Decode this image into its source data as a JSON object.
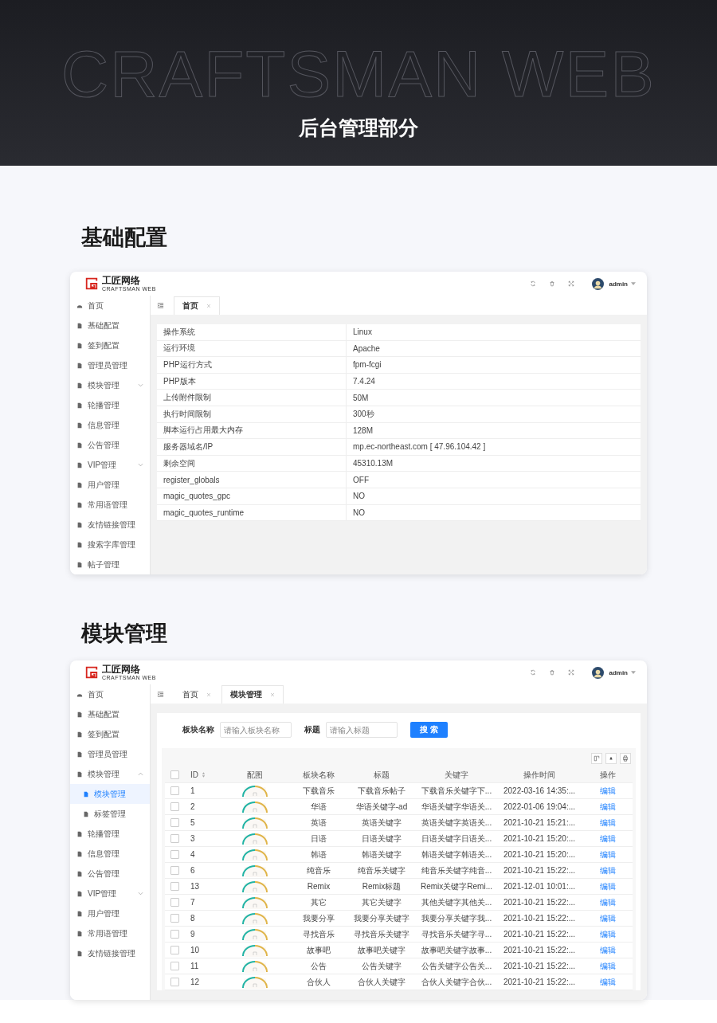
{
  "banner": {
    "lettering": "CRAFTSMAN WEB",
    "title": "后台管理部分"
  },
  "sections": [
    {
      "heading": "基础配置",
      "kind": "info",
      "app": {
        "brand": "工匠网络",
        "tagline": "CRAFTSMAN WEB",
        "user": "admin",
        "sidebar": [
          {
            "label": "首页",
            "kind": "home",
            "selected": false
          },
          {
            "label": "基础配置",
            "kind": "page",
            "selected": false
          },
          {
            "label": "签到配置",
            "kind": "page",
            "selected": false
          },
          {
            "label": "管理员管理",
            "kind": "page",
            "selected": false
          },
          {
            "label": "模块管理",
            "kind": "page",
            "selected": false,
            "expanded": false
          },
          {
            "label": "轮播管理",
            "kind": "page",
            "selected": false
          },
          {
            "label": "信息管理",
            "kind": "page",
            "selected": false
          },
          {
            "label": "公告管理",
            "kind": "page",
            "selected": false
          },
          {
            "label": "VIP管理",
            "kind": "page",
            "selected": false,
            "expanded": false
          },
          {
            "label": "用户管理",
            "kind": "page",
            "selected": false
          },
          {
            "label": "常用语管理",
            "kind": "page",
            "selected": false
          },
          {
            "label": "友情链接管理",
            "kind": "page",
            "selected": false
          },
          {
            "label": "搜索字库管理",
            "kind": "page",
            "selected": false
          },
          {
            "label": "帖子管理",
            "kind": "page",
            "selected": false
          }
        ],
        "tabs": [
          {
            "label": "首页",
            "selected": true
          }
        ],
        "info_rows": [
          {
            "key": "操作系统",
            "value": "Linux"
          },
          {
            "key": "运行环境",
            "value": "Apache"
          },
          {
            "key": "PHP运行方式",
            "value": "fpm-fcgi"
          },
          {
            "key": "PHP版本",
            "value": "7.4.24"
          },
          {
            "key": "上传附件限制",
            "value": "50M"
          },
          {
            "key": "执行时间限制",
            "value": "300秒"
          },
          {
            "key": "脚本运行占用最大内存",
            "value": "128M"
          },
          {
            "key": "服务器域名/IP",
            "value": "mp.ec-northeast.com [ 47.96.104.42 ]"
          },
          {
            "key": "剩余空间",
            "value": "45310.13M"
          },
          {
            "key": "register_globals",
            "value": "OFF"
          },
          {
            "key": "magic_quotes_gpc",
            "value": "NO"
          },
          {
            "key": "magic_quotes_runtime",
            "value": "NO"
          }
        ]
      }
    },
    {
      "heading": "模块管理",
      "kind": "list",
      "app": {
        "brand": "工匠网络",
        "tagline": "CRAFTSMAN WEB",
        "user": "admin",
        "sidebar": [
          {
            "label": "首页",
            "kind": "home",
            "selected": false
          },
          {
            "label": "基础配置",
            "kind": "page",
            "selected": false
          },
          {
            "label": "签到配置",
            "kind": "page",
            "selected": false
          },
          {
            "label": "管理员管理",
            "kind": "page",
            "selected": false
          },
          {
            "label": "模块管理",
            "kind": "page",
            "selected": false,
            "expanded": true,
            "children": [
              {
                "label": "模块管理",
                "kind": "page",
                "selected": true
              },
              {
                "label": "标签管理",
                "kind": "page",
                "selected": false
              }
            ]
          },
          {
            "label": "轮播管理",
            "kind": "page",
            "selected": false
          },
          {
            "label": "信息管理",
            "kind": "page",
            "selected": false
          },
          {
            "label": "公告管理",
            "kind": "page",
            "selected": false
          },
          {
            "label": "VIP管理",
            "kind": "page",
            "selected": false,
            "expanded": false
          },
          {
            "label": "用户管理",
            "kind": "page",
            "selected": false
          },
          {
            "label": "常用语管理",
            "kind": "page",
            "selected": false
          },
          {
            "label": "友情链接管理",
            "kind": "page",
            "selected": false
          }
        ],
        "tabs": [
          {
            "label": "首页",
            "selected": false
          },
          {
            "label": "模块管理",
            "selected": true
          }
        ],
        "filters": [
          {
            "label": "板块名称",
            "placeholder": "请输入板块名称"
          },
          {
            "label": "标题",
            "placeholder": "请输入标题"
          }
        ],
        "search_button": "搜 索",
        "table": {
          "all_checked": false,
          "columns": [
            "ID",
            "配图",
            "板块名称",
            "标题",
            "关键字",
            "操作时间",
            "操作"
          ],
          "rows": [
            {
              "checked": false,
              "id": "1",
              "name": "下载音乐",
              "title": "下载音乐帖子",
              "keyword": "下载音乐关键字下...",
              "time": "2022-03-16 14:35:...",
              "action": "编辑"
            },
            {
              "checked": false,
              "id": "2",
              "name": "华语",
              "title": "华语关键字-ad",
              "keyword": "华语关键字华语关...",
              "time": "2022-01-06 19:04:...",
              "action": "编辑"
            },
            {
              "checked": false,
              "id": "5",
              "name": "英语",
              "title": "英语关键字",
              "keyword": "英语关键字英语关...",
              "time": "2021-10-21 15:21:...",
              "action": "编辑"
            },
            {
              "checked": false,
              "id": "3",
              "name": "日语",
              "title": "日语关键字",
              "keyword": "日语关键字日语关...",
              "time": "2021-10-21 15:20:...",
              "action": "编辑"
            },
            {
              "checked": false,
              "id": "4",
              "name": "韩语",
              "title": "韩语关键字",
              "keyword": "韩语关键字韩语关...",
              "time": "2021-10-21 15:20:...",
              "action": "编辑"
            },
            {
              "checked": false,
              "id": "6",
              "name": "纯音乐",
              "title": "纯音乐关键字",
              "keyword": "纯音乐关键字纯音...",
              "time": "2021-10-21 15:22:...",
              "action": "编辑"
            },
            {
              "checked": false,
              "id": "13",
              "name": "Remix",
              "title": "Remix标题",
              "keyword": "Remix关键字Remi...",
              "time": "2021-12-01 10:01:...",
              "action": "编辑"
            },
            {
              "checked": false,
              "id": "7",
              "name": "其它",
              "title": "其它关键字",
              "keyword": "其他关键字其他关...",
              "time": "2021-10-21 15:22:...",
              "action": "编辑"
            },
            {
              "checked": false,
              "id": "8",
              "name": "我要分享",
              "title": "我要分享关键字",
              "keyword": "我要分享关键字我...",
              "time": "2021-10-21 15:22:...",
              "action": "编辑"
            },
            {
              "checked": false,
              "id": "9",
              "name": "寻找音乐",
              "title": "寻找音乐关键字",
              "keyword": "寻找音乐关键字寻...",
              "time": "2021-10-21 15:22:...",
              "action": "编辑"
            },
            {
              "checked": false,
              "id": "10",
              "name": "故事吧",
              "title": "故事吧关键字",
              "keyword": "故事吧关键字故事...",
              "time": "2021-10-21 15:22:...",
              "action": "编辑"
            },
            {
              "checked": false,
              "id": "11",
              "name": "公告",
              "title": "公告关键字",
              "keyword": "公告关键字公告关...",
              "time": "2021-10-21 15:22:...",
              "action": "编辑"
            },
            {
              "checked": false,
              "id": "12",
              "name": "合伙人",
              "title": "合伙人关键字",
              "keyword": "合伙人关键字合伙...",
              "time": "2021-10-21 15:22:...",
              "action": "编辑"
            }
          ]
        }
      }
    }
  ]
}
